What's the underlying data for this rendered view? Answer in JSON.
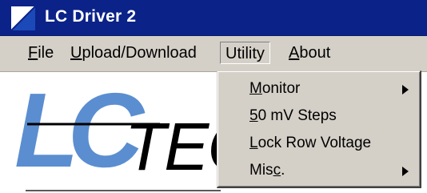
{
  "window": {
    "title": "LC Driver 2",
    "icon": "lc-app-icon",
    "title_color": "#0b2288"
  },
  "menubar": {
    "items": [
      {
        "label_first": "F",
        "label_rest": "ile"
      },
      {
        "label_first": "U",
        "label_rest": "pload/Download"
      },
      {
        "label": "Utility"
      },
      {
        "label_first": "A",
        "label_rest": "bout"
      }
    ]
  },
  "utility_menu": {
    "items": [
      {
        "pre": "",
        "ul": "M",
        "post": "onitor",
        "submenu": true
      },
      {
        "pre": "",
        "ul": "5",
        "post": "0 mV Steps",
        "submenu": false
      },
      {
        "pre": "",
        "ul": "L",
        "post": "ock Row Voltage",
        "submenu": false
      },
      {
        "pre": "Mis",
        "ul": "c",
        "post": ".",
        "submenu": true
      }
    ]
  },
  "logo": {
    "letters_big": "LC",
    "letters_tail": "TEC",
    "brand_blue": "#5b8ed0"
  }
}
